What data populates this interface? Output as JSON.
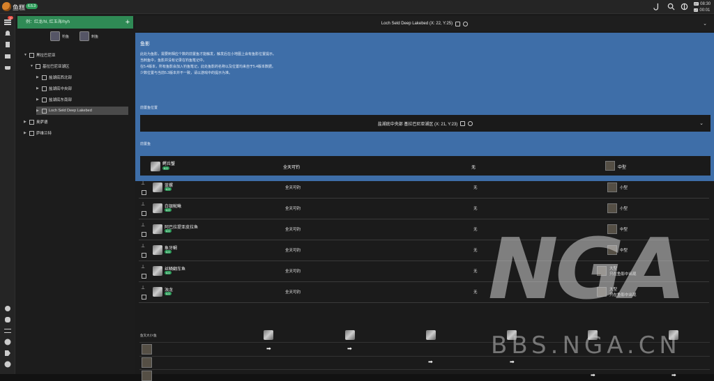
{
  "app": {
    "title": "鱼糕",
    "version": "6.5.3"
  },
  "clock": {
    "et_label": "ET",
    "et_time": "08:30",
    "lt_label": "LT",
    "lt_time": "00:01"
  },
  "rail": {
    "badge": "10"
  },
  "sidebar": {
    "search_placeholder": "例：红龙/hl, 红玉海/hyh",
    "filter_fish": "钓鱼",
    "filter_spear": "刺鱼",
    "tree": [
      {
        "label": "黑拉巴尼亚"
      },
      {
        "label": "基拉巴尼亚湖区"
      },
      {
        "label": "盐湖底西北部"
      },
      {
        "label": "盐湖底中央部"
      },
      {
        "label": "盐湖底东南部"
      },
      {
        "label": "Loch Seld Deep Lakebed"
      },
      {
        "label": "奥萨德"
      },
      {
        "label": "萨维兰特"
      }
    ]
  },
  "header": {
    "title": "Loch Seld Deep Lakebed  (X: 22, Y:25)"
  },
  "panel": {
    "title": "鱼影",
    "desc": [
      "此处为鱼影，需要刺相应个数的前置鱼才能触发，触发后在小地图上会有鱼影位置提示。",
      "当刺鱼中，鱼影并没有记录在钓鱼笔记中。",
      "在5.4版本，所有鱼影会加入钓鱼笔记，此处鱼影的名称以及位置均来自于5.4版本数据。",
      "少数位置与当前5.3版本并不一致，请以游戏中的提示为准。"
    ],
    "pos_label": "前置鱼位置",
    "pos_title": "盐湖底中央部  基拉巴尼亚湖区  (X: 21, Y:23)",
    "pred_label": "前置鱼",
    "pred_fish": {
      "name": "鳄兵蟹",
      "level": "4.0",
      "time": "全天可钓",
      "weather": "无",
      "size": "中型"
    }
  },
  "fish": [
    {
      "name": "蓝螺",
      "level": "4.0",
      "time": "全天可钓",
      "weather": "无",
      "size": "小型"
    },
    {
      "name": "白银鱿鳅",
      "level": "4.0",
      "time": "全天可钓",
      "weather": "无",
      "size": "小型"
    },
    {
      "name": "阿巴拉提亚皮拉鱼",
      "level": "4.0",
      "time": "全天可钓",
      "weather": "无",
      "size": "中型"
    },
    {
      "name": "象牙鲷",
      "level": "4.0",
      "time": "全天可钓",
      "weather": "无",
      "size": "中型"
    },
    {
      "name": "丝鳞翻车鱼",
      "level": "4.0",
      "time": "全天可钓",
      "weather": "无",
      "size": "大型",
      "note": "只在鱼影中出现"
    },
    {
      "name": "浊龙",
      "level": "4.0",
      "time": "全天可钓",
      "weather": "无",
      "size": "大型",
      "note": "只在鱼影中出现"
    }
  ],
  "grid": {
    "corner": "鱼叉大小\\鱼"
  },
  "watermark": {
    "text": "BBS.NGA.CN",
    "logo": "NGA"
  }
}
